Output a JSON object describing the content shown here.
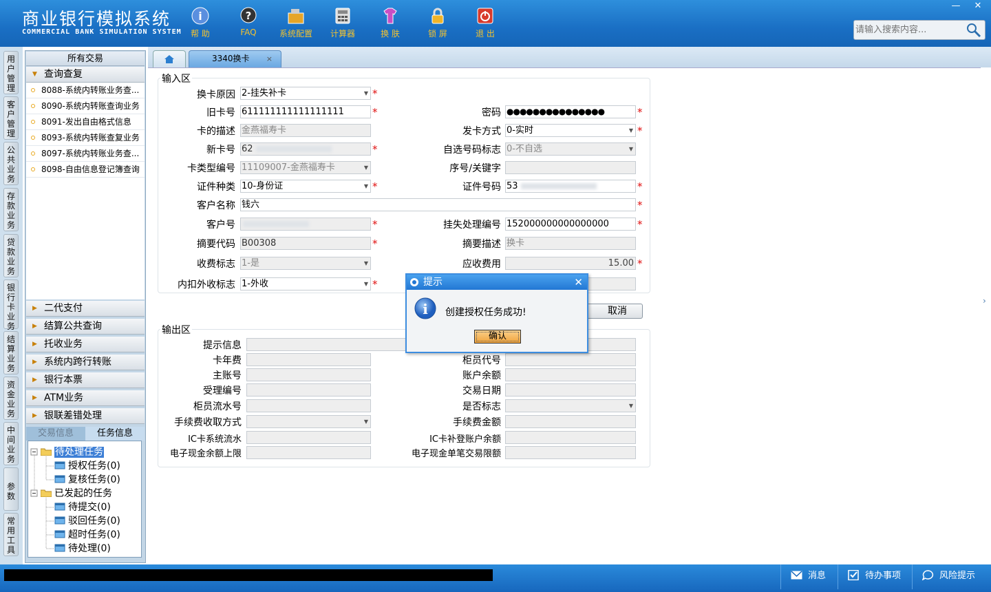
{
  "app": {
    "title": "商业银行模拟系统",
    "subtitle": "COMMERCIAL BANK SIMULATION SYSTEM"
  },
  "toolbar": [
    {
      "label": "帮 助",
      "icon": "info-icon"
    },
    {
      "label": "FAQ",
      "icon": "help-icon"
    },
    {
      "label": "系统配置",
      "icon": "config-icon"
    },
    {
      "label": "计算器",
      "icon": "calculator-icon"
    },
    {
      "label": "换 肤",
      "icon": "skin-icon"
    },
    {
      "label": "锁 屏",
      "icon": "lock-icon"
    },
    {
      "label": "退 出",
      "icon": "power-icon"
    }
  ],
  "window": {
    "minimize": "—",
    "close": "✕"
  },
  "search": {
    "placeholder": "请输入搜索内容..."
  },
  "side_tabs": [
    "用户管理",
    "客户管理",
    "公共业务",
    "存款业务",
    "贷款业务",
    "银行卡业务",
    "结算业务",
    "资金业务",
    "中间业务",
    "参数",
    "常用工具"
  ],
  "nav": {
    "all": "所有交易",
    "group_open": "查询查复",
    "items": [
      "8088-系统内转账业务查...",
      "8090-系统内转账查询业务",
      "8091-发出自由格式信息",
      "8093-系统内转账查复业务",
      "8097-系统内转账业务查...",
      "8098-自由信息登记簿查询"
    ],
    "groups": [
      "二代支付",
      "结算公共查询",
      "托收业务",
      "系统内跨行转账",
      "银行本票",
      "ATM业务",
      "银联差错处理"
    ],
    "task_tabs": [
      "交易信息",
      "任务信息"
    ],
    "tree": {
      "pending": "待处理任务",
      "auth": "授权任务(0)",
      "review": "复核任务(0)",
      "initiated": "已发起的任务",
      "to_submit": "待提交(0)",
      "rejected": "驳回任务(0)",
      "timeout": "超时任务(0)",
      "to_process": "待处理(0)"
    }
  },
  "tabs": {
    "active": "3340换卡",
    "close": "×"
  },
  "input_section": {
    "title": "输入区",
    "fields": {
      "reason": {
        "label": "换卡原因",
        "value": "2-挂失补卡"
      },
      "old_card": {
        "label": "旧卡号",
        "value": "611111111111111111"
      },
      "password": {
        "label": "密码",
        "value": "●●●●●●●●●●●●●●●"
      },
      "card_desc": {
        "label": "卡的描述",
        "value": "金燕福寿卡"
      },
      "issue_method": {
        "label": "发卡方式",
        "value": "0-实时"
      },
      "new_card": {
        "label": "新卡号",
        "value": "62"
      },
      "self_select": {
        "label": "自选号码标志",
        "value": "0-不自选"
      },
      "card_type": {
        "label": "卡类型编号",
        "value": "11109007-金燕福寿卡"
      },
      "serial_key": {
        "label": "序号/关键字",
        "value": ""
      },
      "id_type": {
        "label": "证件种类",
        "value": "10-身份证"
      },
      "id_no": {
        "label": "证件号码",
        "value": "53"
      },
      "customer_name": {
        "label": "客户名称",
        "value": "钱六"
      },
      "customer_no": {
        "label": "客户号",
        "value": ""
      },
      "loss_no": {
        "label": "挂失处理编号",
        "value": "152000000000000000"
      },
      "summary_code": {
        "label": "摘要代码",
        "value": "B00308"
      },
      "summary_desc": {
        "label": "摘要描述",
        "value": "换卡"
      },
      "fee_flag": {
        "label": "收费标志",
        "value": "1-是"
      },
      "fee_due": {
        "label": "应收费用",
        "value": "15.00"
      },
      "fee_inout": {
        "label": "内扣外收标志",
        "value": "1-外收"
      }
    }
  },
  "output_section": {
    "title": "输出区",
    "labels": {
      "prompt": "提示信息",
      "card_fee": "卡年费",
      "teller_code": "柜员代号",
      "main_acct": "主账号",
      "balance": "账户余额",
      "accept_no": "受理编号",
      "tx_date": "交易日期",
      "teller_serial": "柜员流水号",
      "yes_no": "是否标志",
      "fee_method": "手续费收取方式",
      "fee_amount": "手续费金额",
      "ic_serial": "IC卡系统流水",
      "ic_balance": "IC卡补登账户余额",
      "ecash_limit": "电子现金余额上限",
      "ecash_single": "电子现金单笔交易限额"
    }
  },
  "buttons": {
    "cancel": "取消"
  },
  "dialog": {
    "title": "提示",
    "message": "创建授权任务成功!",
    "ok": "确认",
    "close": "✕"
  },
  "status": {
    "message": "消息",
    "todo": "待办事项",
    "risk": "风险提示"
  }
}
